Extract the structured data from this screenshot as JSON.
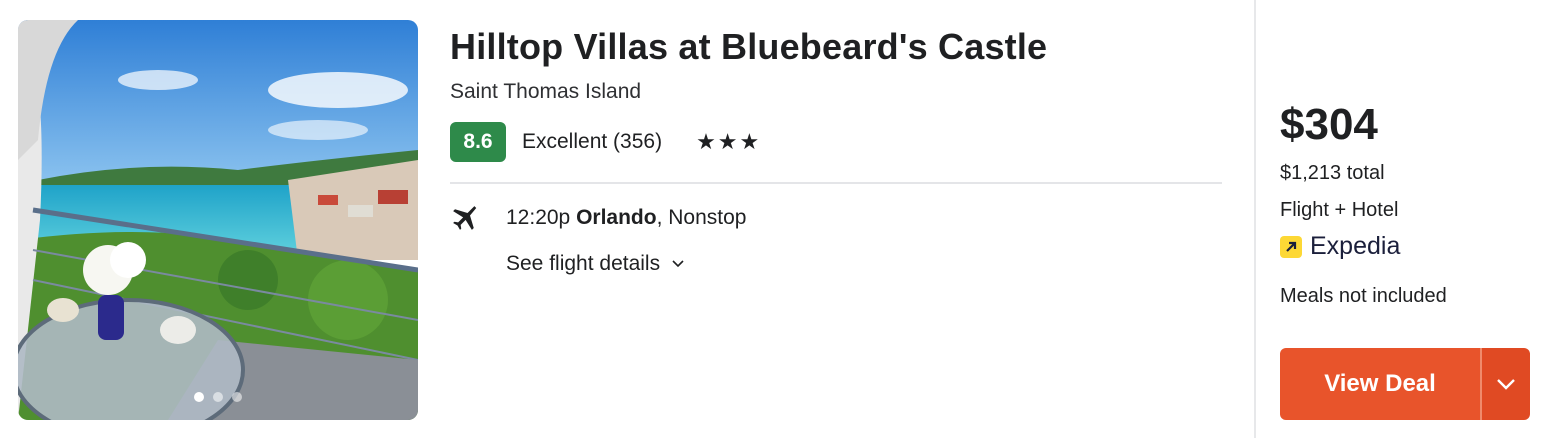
{
  "hotel": {
    "name": "Hilltop Villas at Bluebeard's Castle",
    "location": "Saint Thomas Island",
    "score": "8.6",
    "rating_label": "Excellent (356)",
    "stars": "★★★",
    "star_count": 3
  },
  "photo": {
    "carousel_dots": 3,
    "active_dot": 1
  },
  "flight": {
    "time": "12:20p",
    "city": "Orlando",
    "type": ", Nonstop",
    "details_link": "See flight details"
  },
  "pricing": {
    "price": "$304",
    "total": "$1,213 total",
    "package_type": "Flight + Hotel",
    "provider": "Expedia",
    "meals": "Meals not included"
  },
  "cta": {
    "label": "View Deal"
  },
  "colors": {
    "score_bg": "#2e8a4a",
    "cta_bg": "#e8542b",
    "provider_logo": "#fdd835"
  }
}
